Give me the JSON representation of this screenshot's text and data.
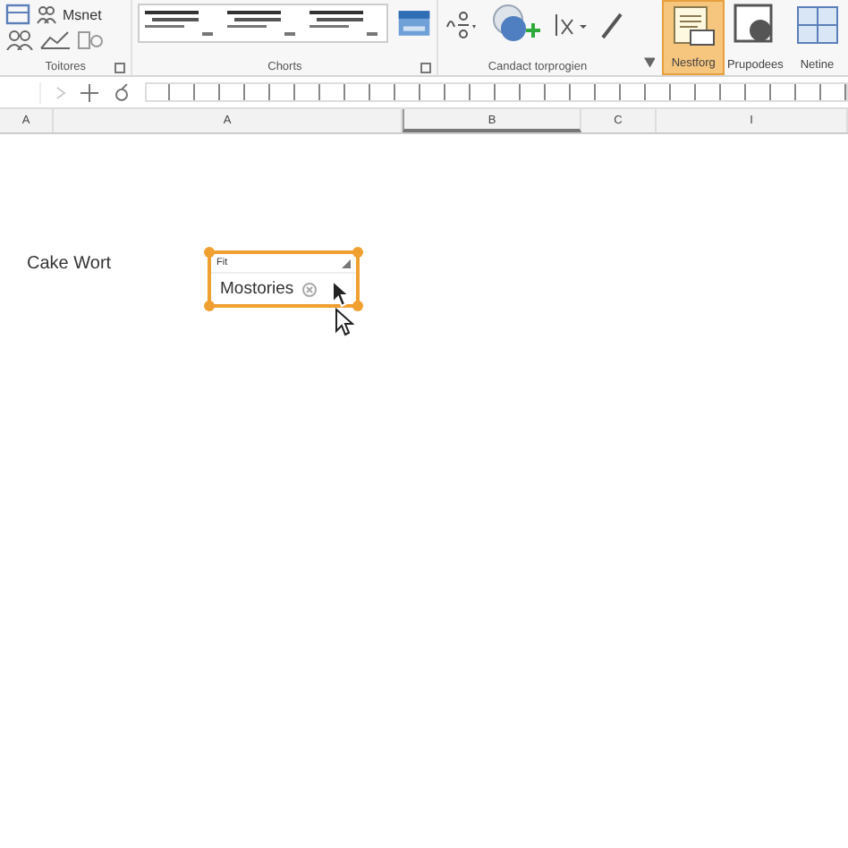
{
  "ribbon": {
    "top_label": "Msnet",
    "groups": [
      {
        "label": "Toitores"
      },
      {
        "label": "Chorts"
      },
      {
        "label": "Candact torprogien"
      }
    ],
    "buttons": [
      {
        "label": "Nestforg",
        "selected": true
      },
      {
        "label": "Prupodees",
        "selected": false
      },
      {
        "label": "Netine",
        "selected": false
      }
    ]
  },
  "sheet": {
    "columns": [
      {
        "label": "A",
        "selected": false
      },
      {
        "label": "A",
        "selected": false
      },
      {
        "label": "B",
        "selected": true
      },
      {
        "label": "C",
        "selected": false
      },
      {
        "label": "I",
        "selected": false
      }
    ],
    "cell_text": "Cake Wort"
  },
  "control": {
    "header": "Fit",
    "label": "Mostories"
  }
}
